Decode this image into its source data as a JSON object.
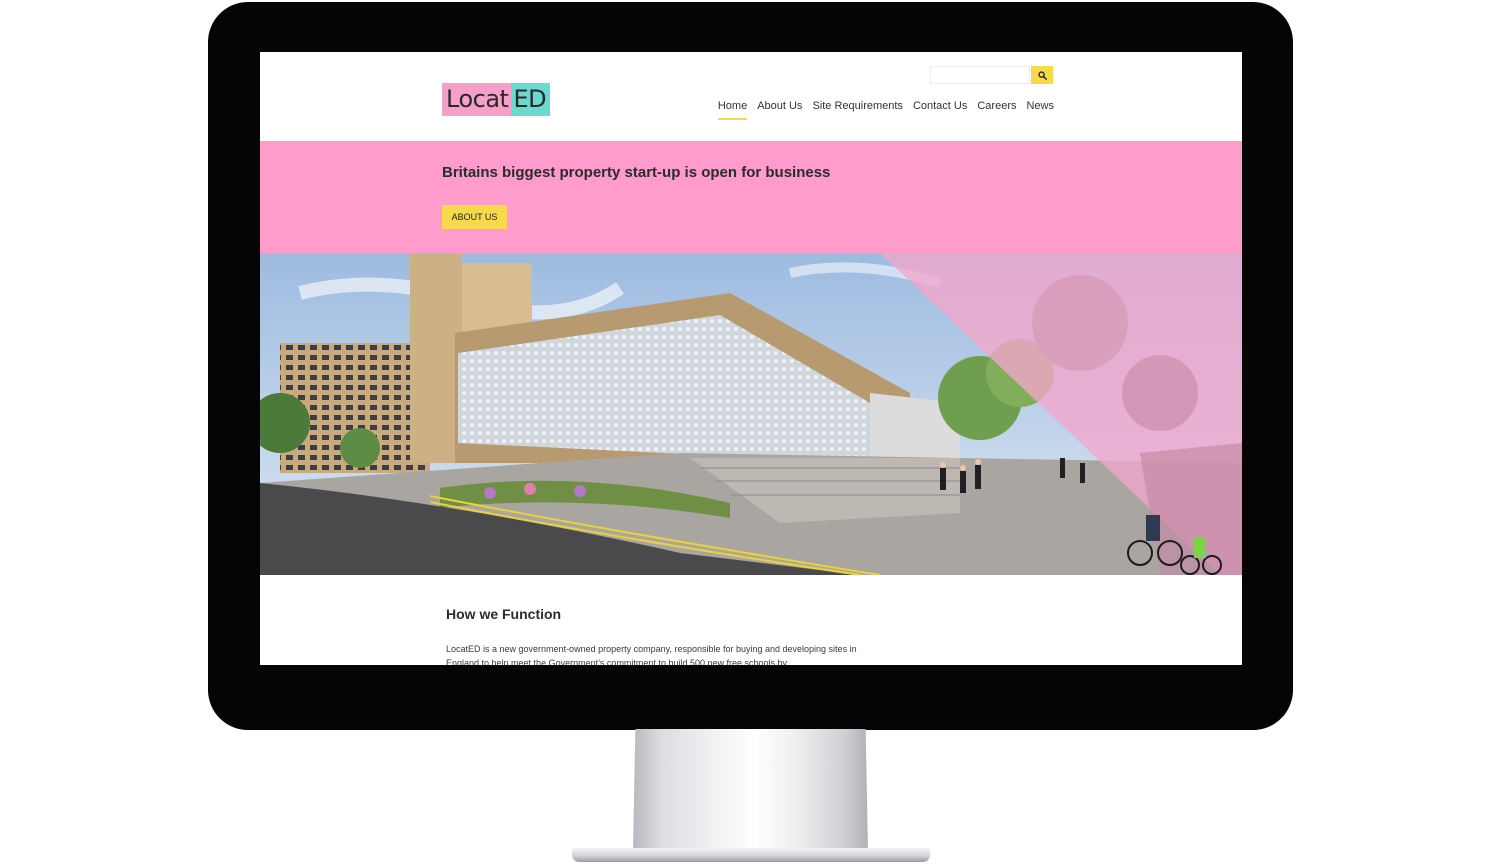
{
  "brand": {
    "logo_part1": "Locat",
    "logo_part2": "ED",
    "pink": "#ff9ccb",
    "teal": "#6cd9cf",
    "yellow": "#f7d94c"
  },
  "search": {
    "placeholder": "",
    "button_icon": "search-icon"
  },
  "nav": {
    "items": [
      "Home",
      "About Us",
      "Site Requirements",
      "Contact Us",
      "Careers",
      "News"
    ],
    "active": "Home"
  },
  "hero": {
    "tagline": "Britains biggest property start-up is open for business",
    "button_label": "ABOUT US"
  },
  "content": {
    "heading": "How we Function",
    "body": "LocatED is a new government-owned property company, responsible for buying and developing sites in England to help meet the Government’s commitment to build 500 new free schools by"
  }
}
